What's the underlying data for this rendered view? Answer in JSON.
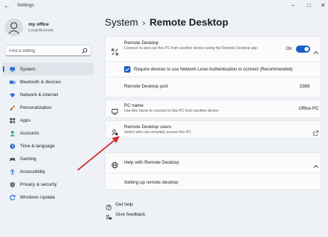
{
  "window": {
    "title": "Settings",
    "back_icon": "back-arrow-icon",
    "controls": [
      "minimize-icon",
      "maximize-icon",
      "close-icon"
    ]
  },
  "profile": {
    "name": "my office",
    "account_type": "Local Account"
  },
  "search": {
    "placeholder": "Find a setting"
  },
  "sidebar": {
    "items": [
      {
        "label": "System",
        "icon": "system-icon",
        "active": true
      },
      {
        "label": "Bluetooth & devices",
        "icon": "bluetooth-icon"
      },
      {
        "label": "Network & internet",
        "icon": "network-icon"
      },
      {
        "label": "Personalization",
        "icon": "brush-icon"
      },
      {
        "label": "Apps",
        "icon": "apps-icon"
      },
      {
        "label": "Accounts",
        "icon": "accounts-icon"
      },
      {
        "label": "Time & language",
        "icon": "time-language-icon"
      },
      {
        "label": "Gaming",
        "icon": "gaming-icon"
      },
      {
        "label": "Accessibility",
        "icon": "accessibility-icon"
      },
      {
        "label": "Privacy & security",
        "icon": "shield-icon"
      },
      {
        "label": "Windows Update",
        "icon": "windows-update-icon"
      }
    ]
  },
  "breadcrumb": {
    "parent": "System",
    "separator": "›",
    "current": "Remote Desktop"
  },
  "remote_desktop": {
    "title": "Remote Desktop",
    "description": "Connect to and use this PC from another device using the Remote Desktop app",
    "toggle_label": "On",
    "enabled": true,
    "nla_label": "Require devices to use Network Level Authentication to connect (Recommended)",
    "nla_checked": true,
    "port_label": "Remote Desktop port",
    "port_value": "3389"
  },
  "pc_name": {
    "title": "PC name",
    "description": "Use this name to connect to this PC from another device",
    "value": "Office-PC"
  },
  "users": {
    "title": "Remote Desktop users",
    "description": "Select who can remotely access this PC"
  },
  "help": {
    "title": "Help with Remote Desktop",
    "link": "Setting up remote desktop"
  },
  "footer": {
    "get_help": "Get help",
    "give_feedback": "Give feedback"
  },
  "colors": {
    "accent": "#1a5fc7",
    "annotation_arrow": "#d42a2a",
    "background": "#eef1f6"
  }
}
